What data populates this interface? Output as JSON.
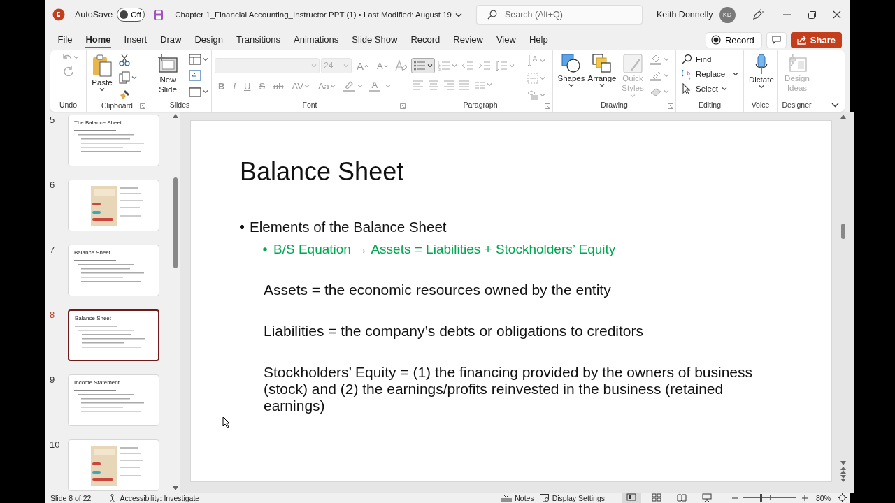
{
  "title_bar": {
    "autosave": {
      "label": "AutoSave",
      "on": false,
      "state": "Off"
    },
    "document_title": "Chapter 1_Financial Accounting_Instructor PPT (1) • Last Modified: August 19",
    "search": {
      "placeholder": "Search (Alt+Q)"
    },
    "user": "Keith Donnelly",
    "avatar": "KD"
  },
  "menu_tabs": [
    {
      "label": "File",
      "selected": false
    },
    {
      "label": "Home",
      "selected": true
    },
    {
      "label": "Insert",
      "selected": false
    },
    {
      "label": "Draw",
      "selected": false
    },
    {
      "label": "Design",
      "selected": false
    },
    {
      "label": "Transitions",
      "selected": false
    },
    {
      "label": "Animations",
      "selected": false
    },
    {
      "label": "Slide Show",
      "selected": false
    },
    {
      "label": "Record",
      "selected": false
    },
    {
      "label": "Review",
      "selected": false
    },
    {
      "label": "View",
      "selected": false
    },
    {
      "label": "Help",
      "selected": false
    }
  ],
  "actions": {
    "record": "Record",
    "share": "Share"
  },
  "ribbon": [
    {
      "kind": "undo",
      "label": "Undo"
    },
    {
      "kind": "clipboard",
      "label": "Clipboard",
      "paste": "Paste"
    },
    {
      "kind": "slides",
      "label": "Slides",
      "new_slide": "New Slide"
    },
    {
      "kind": "font",
      "label": "Font",
      "disabled": true,
      "font_size": "24",
      "size_buttons": [
        "A",
        "A"
      ],
      "format_buttons": [
        "B",
        "I",
        "U",
        "S",
        "ab",
        "AV",
        "Aa"
      ],
      "color_button": "A"
    },
    {
      "kind": "paragraph",
      "label": "Paragraph"
    },
    {
      "kind": "drawing",
      "label": "Drawing",
      "buttons": [
        {
          "label": "Shapes",
          "disabled": false
        },
        {
          "label": "Arrange",
          "disabled": false
        },
        {
          "label": "Quick Styles",
          "disabled": true
        }
      ]
    },
    {
      "kind": "editing",
      "label": "Editing",
      "buttons": [
        {
          "label": "Find"
        },
        {
          "label": "Replace"
        },
        {
          "label": "Select"
        }
      ]
    },
    {
      "kind": "voice",
      "label": "Voice",
      "buttons": [
        {
          "label": "Dictate",
          "disabled": false
        }
      ]
    },
    {
      "kind": "designer",
      "label": "Designer",
      "buttons": [
        {
          "label": "Design Ideas",
          "disabled": true
        }
      ]
    }
  ],
  "thumbnails": [
    {
      "number": "5",
      "kind": "text",
      "title": "The Balance Sheet",
      "selected": false
    },
    {
      "number": "6",
      "selected": false
    },
    {
      "number": "7",
      "kind": "text",
      "title": "Balance Sheet",
      "selected": false
    },
    {
      "number": "8",
      "kind": "text",
      "title": "Balance Sheet",
      "selected": true
    },
    {
      "number": "9",
      "kind": "text",
      "title": "Income Statement",
      "selected": false
    },
    {
      "number": "10",
      "selected": false
    }
  ],
  "slide": {
    "title": "Balance Sheet",
    "blocks": [
      {
        "kind": "bullet",
        "text": "Elements of the Balance Sheet"
      },
      {
        "kind": "sub_bullet",
        "text": "B/S Equation → Assets = Liabilities + Stockholders’ Equity"
      },
      {
        "kind": "paragraph",
        "text": "Assets = the economic resources owned by the entity"
      },
      {
        "kind": "paragraph",
        "text": "Liabilities = the company’s debts or obligations to creditors"
      },
      {
        "kind": "paragraph",
        "text": "Stockholders’ Equity = (1) the financing provided by the owners of business (stock) and (2) the earnings/profits reinvested in the business (retained earnings)"
      }
    ]
  },
  "status_bar": {
    "slide_position": "Slide 8 of 22",
    "accessibility": "Accessibility: Investigate",
    "notes": "Notes",
    "display_settings": "Display Settings",
    "views": [
      {
        "selected": true
      },
      {
        "selected": false
      },
      {
        "selected": false
      },
      {
        "selected": false
      }
    ],
    "zoom": {
      "level": 0.33,
      "reading": "80%"
    }
  }
}
